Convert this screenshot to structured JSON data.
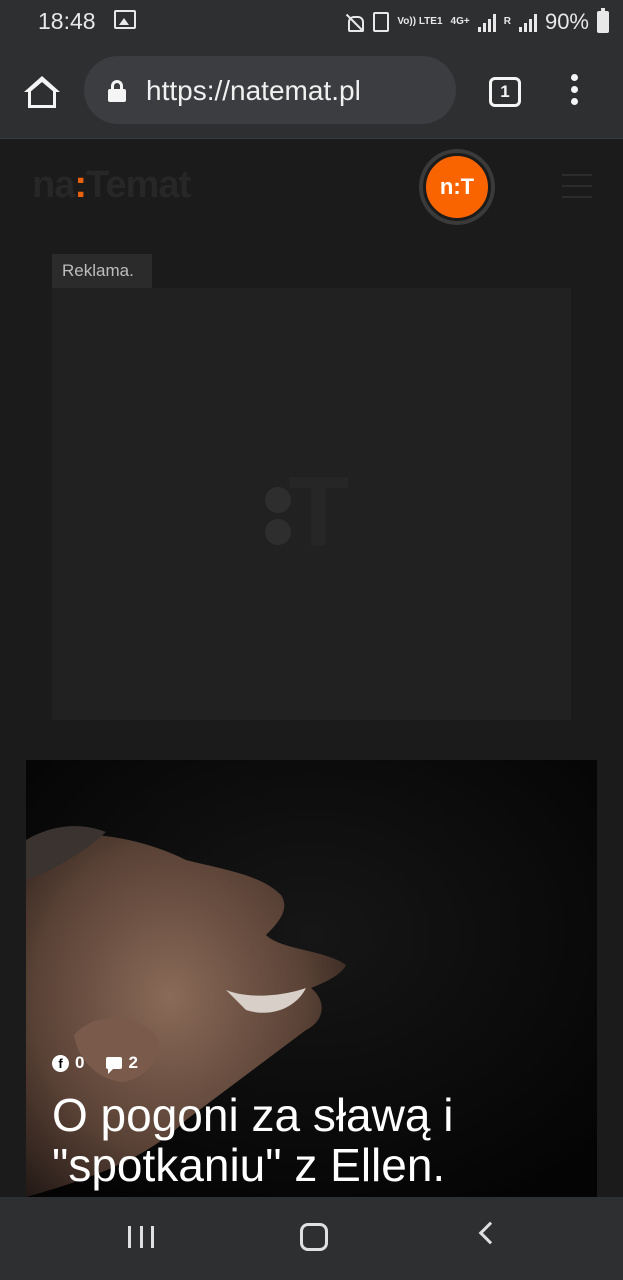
{
  "status_bar": {
    "time": "18:48",
    "net_volte": "Vo)) LTE1",
    "net_4g": "4G+",
    "roaming": "R",
    "battery": "90%"
  },
  "browser": {
    "url": "https://natemat.pl",
    "tab_count": "1"
  },
  "site": {
    "logo_part1": "na",
    "logo_colon": ":",
    "logo_part2": "Temat",
    "badge_text": "n:T"
  },
  "ad": {
    "label": "Reklama.",
    "placeholder_t": "T"
  },
  "article": {
    "facebook_count": "0",
    "comment_count": "2",
    "title": "O pogoni za sławą i \"spotkaniu\" z Ellen."
  },
  "colors": {
    "accent": "#fa6400",
    "background": "#1b1b1b",
    "chrome": "#2e2f31"
  }
}
